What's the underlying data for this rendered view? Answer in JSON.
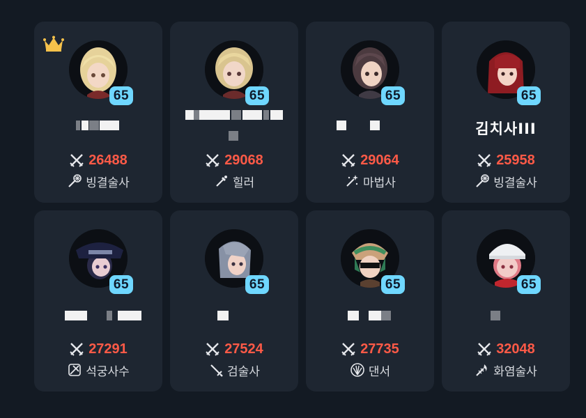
{
  "players": [
    {
      "name": "",
      "level": "65",
      "power": "26488",
      "class": "빙결술사",
      "class_icon": "frost-staff-icon",
      "crown": true
    },
    {
      "name": "",
      "level": "65",
      "power": "29068",
      "class": "힐러",
      "class_icon": "healer-wand-icon",
      "crown": false
    },
    {
      "name": "",
      "level": "65",
      "power": "29064",
      "class": "마법사",
      "class_icon": "magic-wand-icon",
      "crown": false
    },
    {
      "name": "김치사III",
      "level": "65",
      "power": "25958",
      "class": "빙결술사",
      "class_icon": "frost-staff-icon",
      "crown": false
    },
    {
      "name": "",
      "level": "65",
      "power": "27291",
      "class": "석궁사수",
      "class_icon": "crossbow-icon",
      "crown": false
    },
    {
      "name": "",
      "level": "65",
      "power": "27524",
      "class": "검술사",
      "class_icon": "sword-icon",
      "crown": false
    },
    {
      "name": "",
      "level": "65",
      "power": "27735",
      "class": "댄서",
      "class_icon": "fan-icon",
      "crown": false
    },
    {
      "name": "",
      "level": "65",
      "power": "32048",
      "class": "화염술사",
      "class_icon": "flame-staff-icon",
      "crown": false
    }
  ],
  "colors": {
    "background": "#131a23",
    "card": "#1e2631",
    "level_badge": "#6fd7ff",
    "power": "#ff5a47",
    "crown": "#f5c14b"
  }
}
